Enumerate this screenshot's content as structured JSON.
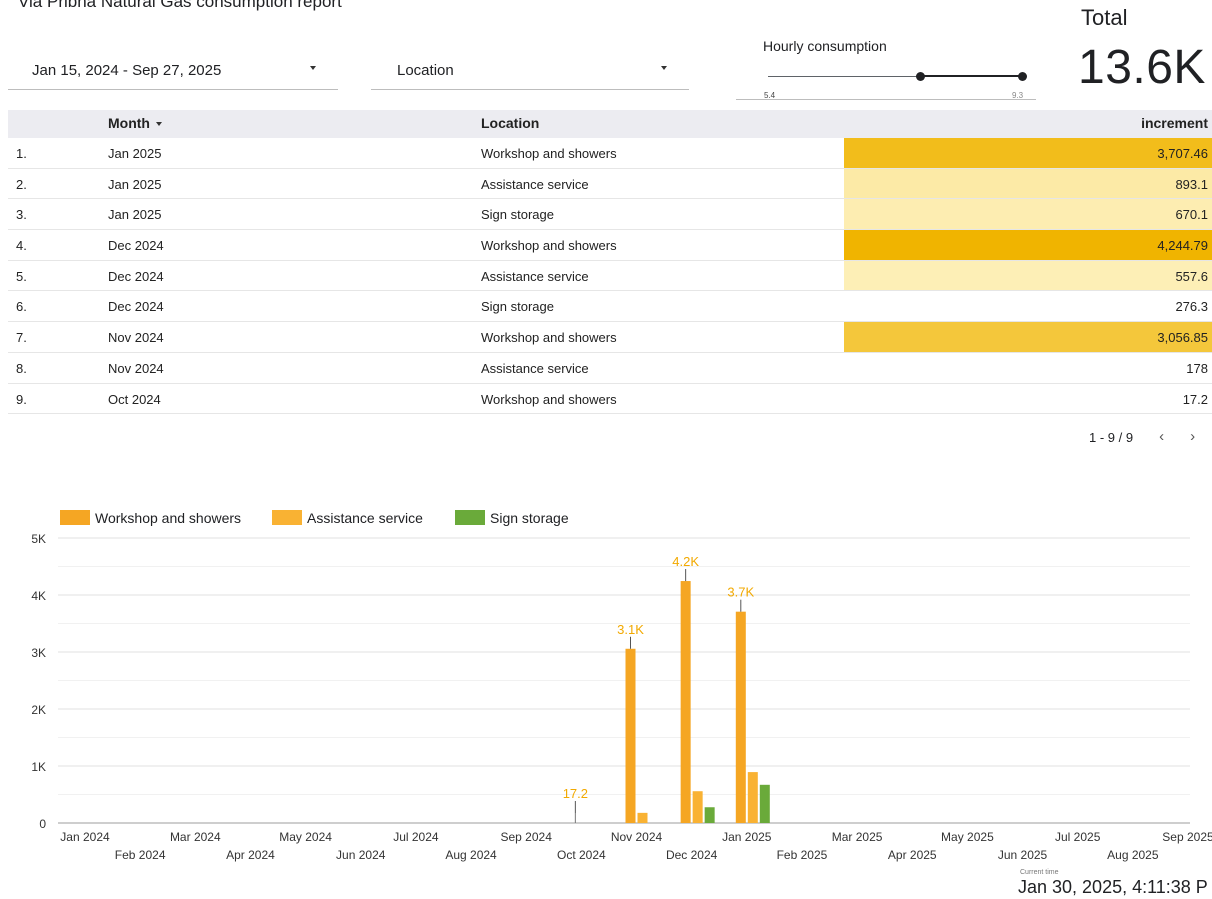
{
  "report": {
    "title": "Via Pribna Natural Gas consumption report"
  },
  "controls": {
    "date_range": "Jan 15, 2024 - Sep 27, 2025",
    "location": "Location"
  },
  "slider": {
    "label": "Hourly consumption",
    "min": "5.4",
    "max": "9.3",
    "range_low_fraction": 0.59,
    "range_high_fraction": 1.0
  },
  "total": {
    "label": "Total",
    "value": "13.6K"
  },
  "table": {
    "headers": {
      "month": "Month",
      "location": "Location",
      "increment": "increment"
    },
    "rows": [
      {
        "idx": "1.",
        "month": "Jan 2025",
        "location": "Workshop and showers",
        "value": "3,707.46",
        "num": 3707.46
      },
      {
        "idx": "2.",
        "month": "Jan 2025",
        "location": "Assistance service",
        "value": "893.1",
        "num": 893.1
      },
      {
        "idx": "3.",
        "month": "Jan 2025",
        "location": "Sign storage",
        "value": "670.1",
        "num": 670.1
      },
      {
        "idx": "4.",
        "month": "Dec 2024",
        "location": "Workshop and showers",
        "value": "4,244.79",
        "num": 4244.79
      },
      {
        "idx": "5.",
        "month": "Dec 2024",
        "location": "Assistance service",
        "value": "557.6",
        "num": 557.6
      },
      {
        "idx": "6.",
        "month": "Dec 2024",
        "location": "Sign storage",
        "value": "276.3",
        "num": 276.3
      },
      {
        "idx": "7.",
        "month": "Nov 2024",
        "location": "Workshop and showers",
        "value": "3,056.85",
        "num": 3056.85
      },
      {
        "idx": "8.",
        "month": "Nov 2024",
        "location": "Assistance service",
        "value": "178",
        "num": 178
      },
      {
        "idx": "9.",
        "month": "Oct 2024",
        "location": "Workshop and showers",
        "value": "17.2",
        "num": 17.2
      }
    ],
    "pagination": {
      "range": "1 - 9 / 9",
      "prev_icon": "chevron-left-icon",
      "next_icon": "chevron-right-icon"
    }
  },
  "colors": {
    "heat_high": "#f0b400",
    "heat_low": "#fff8d2",
    "series_workshop": "#f5a623",
    "series_assistance": "#f9b233",
    "series_sign": "#6aaa3a",
    "label_color": "#f2a900"
  },
  "chart_data": {
    "type": "bar",
    "categories": [
      "Jan 2024",
      "Feb 2024",
      "Mar 2024",
      "Apr 2024",
      "May 2024",
      "Jun 2024",
      "Jul 2024",
      "Aug 2024",
      "Sep 2024",
      "Oct 2024",
      "Nov 2024",
      "Dec 2024",
      "Jan 2025",
      "Feb 2025",
      "Mar 2025",
      "Apr 2025",
      "May 2025",
      "Jun 2025",
      "Jul 2025",
      "Aug 2025",
      "Sep 2025"
    ],
    "series": [
      {
        "name": "Workshop and showers",
        "values": [
          0,
          0,
          0,
          0,
          0,
          0,
          0,
          0,
          0,
          17.2,
          3056.85,
          4244.79,
          3707.46,
          0,
          0,
          0,
          0,
          0,
          0,
          0,
          0
        ]
      },
      {
        "name": "Assistance service",
        "values": [
          0,
          0,
          0,
          0,
          0,
          0,
          0,
          0,
          0,
          0,
          178,
          557.6,
          893.1,
          0,
          0,
          0,
          0,
          0,
          0,
          0,
          0
        ]
      },
      {
        "name": "Sign storage",
        "values": [
          0,
          0,
          0,
          0,
          0,
          0,
          0,
          0,
          0,
          0,
          0,
          276.3,
          670.1,
          0,
          0,
          0,
          0,
          0,
          0,
          0,
          0
        ]
      }
    ],
    "data_labels": [
      {
        "category": "Oct 2024",
        "text": "17.2"
      },
      {
        "category": "Nov 2024",
        "text": "3.1K"
      },
      {
        "category": "Dec 2024",
        "text": "4.2K"
      },
      {
        "category": "Jan 2025",
        "text": "3.7K"
      }
    ],
    "y_ticks": [
      {
        "v": 0,
        "label": "0"
      },
      {
        "v": 1000,
        "label": "1K"
      },
      {
        "v": 2000,
        "label": "2K"
      },
      {
        "v": 3000,
        "label": "3K"
      },
      {
        "v": 4000,
        "label": "4K"
      },
      {
        "v": 5000,
        "label": "5K"
      }
    ],
    "ylim": [
      0,
      5000
    ],
    "grid": true,
    "legend": "top-left"
  },
  "footer": {
    "label": "Current time",
    "time": "Jan 30, 2025, 4:11:38 P"
  }
}
